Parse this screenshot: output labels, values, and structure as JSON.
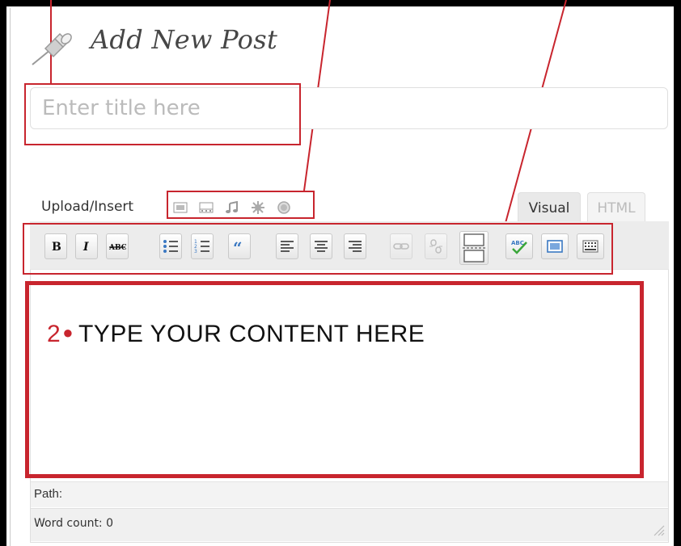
{
  "page": {
    "title": "Add New Post",
    "title_icon": "pushpin-icon"
  },
  "title_field": {
    "placeholder": "Enter title here",
    "value": ""
  },
  "media": {
    "label": "Upload/Insert",
    "icons": [
      "image-icon",
      "video-icon",
      "audio-icon",
      "media-icon",
      "other-icon"
    ]
  },
  "editor_tabs": {
    "visual": "Visual",
    "html": "HTML",
    "active": "Visual"
  },
  "toolbar": {
    "buttons": [
      {
        "name": "bold",
        "icon": "bold-icon",
        "enabled": true
      },
      {
        "name": "italic",
        "icon": "italic-icon",
        "enabled": true
      },
      {
        "name": "strikethrough",
        "icon": "strikethrough-icon",
        "enabled": true
      },
      {
        "name": "bullet-list",
        "icon": "bullet-list-icon",
        "enabled": true
      },
      {
        "name": "numbered-list",
        "icon": "numbered-list-icon",
        "enabled": true
      },
      {
        "name": "blockquote",
        "icon": "blockquote-icon",
        "enabled": true
      },
      {
        "name": "align-left",
        "icon": "align-left-icon",
        "enabled": true
      },
      {
        "name": "align-center",
        "icon": "align-center-icon",
        "enabled": true
      },
      {
        "name": "align-right",
        "icon": "align-right-icon",
        "enabled": true
      },
      {
        "name": "insert-link",
        "icon": "link-icon",
        "enabled": false
      },
      {
        "name": "remove-link",
        "icon": "unlink-icon",
        "enabled": false
      },
      {
        "name": "more-tag",
        "icon": "more-tag-icon",
        "enabled": true
      },
      {
        "name": "spellcheck",
        "icon": "spellcheck-icon",
        "enabled": true
      },
      {
        "name": "fullscreen",
        "icon": "fullscreen-icon",
        "enabled": true
      },
      {
        "name": "kitchen-sink",
        "icon": "kitchen-sink-icon",
        "enabled": true
      }
    ]
  },
  "content": {
    "hint_number": "2",
    "hint_text": "TYPE YOUR CONTENT HERE"
  },
  "status": {
    "path_label": "Path:",
    "word_count_label": "Word count: 0"
  },
  "colors": {
    "callout": "#c8252e"
  }
}
